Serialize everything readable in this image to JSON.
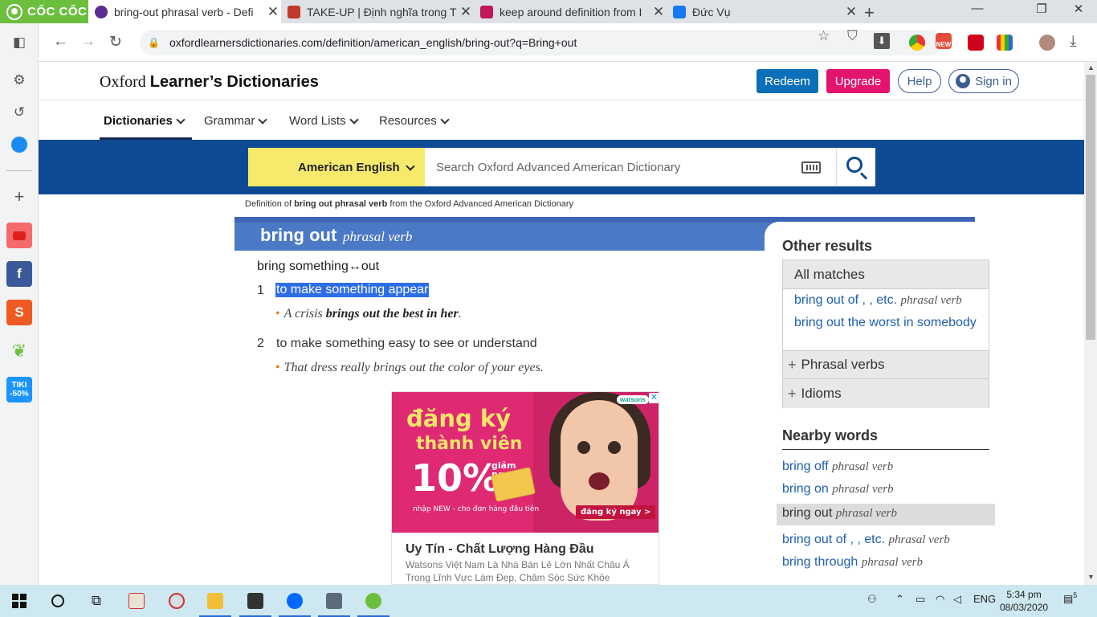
{
  "browser": {
    "brand": "CỐC CỐC",
    "tabs": [
      {
        "title": "bring-out phrasal verb - Defi",
        "color": "#5b2d8e",
        "active": true
      },
      {
        "title": "TAKE-UP | Định nghĩa trong T",
        "color": "#c0392b",
        "active": false
      },
      {
        "title": "keep around definition from I",
        "color": "#c2185b",
        "active": false
      },
      {
        "title": "Đức Vụ",
        "color": "#1877f2",
        "active": false
      }
    ],
    "url": "oxfordlearnersdictionaries.com/definition/american_english/bring-out?q=Bring+out",
    "new_badge": "NEW"
  },
  "sidebar": {
    "icons": [
      "panel-icon",
      "settings-icon",
      "history-icon",
      "messenger-icon",
      "add-icon",
      "youtube-icon",
      "facebook-icon",
      "shopee-icon",
      "coccoc-leaf-icon",
      "tiki-icon"
    ],
    "tiki_label": "TIKI -50%"
  },
  "site": {
    "logo_serif": "Oxford",
    "logo_bold": "Learner’s Dictionaries",
    "redeem": "Redeem",
    "upgrade": "Upgrade",
    "help": "Help",
    "signin": "Sign in",
    "nav": [
      "Dictionaries",
      "Grammar",
      "Word Lists",
      "Resources"
    ],
    "dictionary_select": "American English",
    "search_placeholder": "Search Oxford Advanced American Dictionary"
  },
  "entry": {
    "source_prefix": "Definition of ",
    "source_word": "bring out phrasal verb",
    "source_suffix": " from the Oxford Advanced American Dictionary",
    "headword": "bring out",
    "pos": "phrasal verb",
    "form": "bring something↔out",
    "senses": [
      {
        "num": "1",
        "def": "to make something appear",
        "ex_pre": "A crisis ",
        "ex_bold": "brings out the best in her",
        "ex_post": "."
      },
      {
        "num": "2",
        "def": "to make something easy to see or understand",
        "ex_pre": "That dress really brings out the color of your eyes.",
        "ex_bold": "",
        "ex_post": ""
      }
    ]
  },
  "ad": {
    "headline1": "đăng ký",
    "headline2": "thành viên",
    "percent": "10%",
    "save": "giảm ngay",
    "small": "nhập NEW - cho đơn hàng đầu tiên",
    "cta": "đăng ký ngay >",
    "brand": "watsons",
    "choices": "✕",
    "title": "Uy Tín - Chất Lượng Hàng Đầu",
    "desc": "Watsons Việt Nam Là Nhà Bán Lẻ Lớn Nhất Châu Á Trong Lĩnh Vực Làm Đẹp, Chăm Sóc Sức Khỏe"
  },
  "other_results": {
    "title": "Other results",
    "all_matches": "All matches",
    "links": [
      {
        "text": "bring out of , , etc.",
        "pos": "phrasal verb"
      },
      {
        "text": "bring out the worst in somebody",
        "pos": ""
      }
    ],
    "phrasal_verbs": "Phrasal verbs",
    "idioms": "Idioms"
  },
  "nearby": {
    "title": "Nearby words",
    "items": [
      {
        "text": "bring off",
        "pos": "phrasal verb",
        "current": false
      },
      {
        "text": "bring on",
        "pos": "phrasal verb",
        "current": false
      },
      {
        "text": "bring out",
        "pos": "phrasal verb",
        "current": true
      },
      {
        "text": "bring out of , , etc.",
        "pos": "phrasal verb",
        "current": false
      },
      {
        "text": "bring through",
        "pos": "phrasal verb",
        "current": false
      }
    ]
  },
  "taskbar": {
    "lang": "ENG",
    "time": "5:34 pm",
    "date": "08/03/2020",
    "notifications": "5"
  }
}
